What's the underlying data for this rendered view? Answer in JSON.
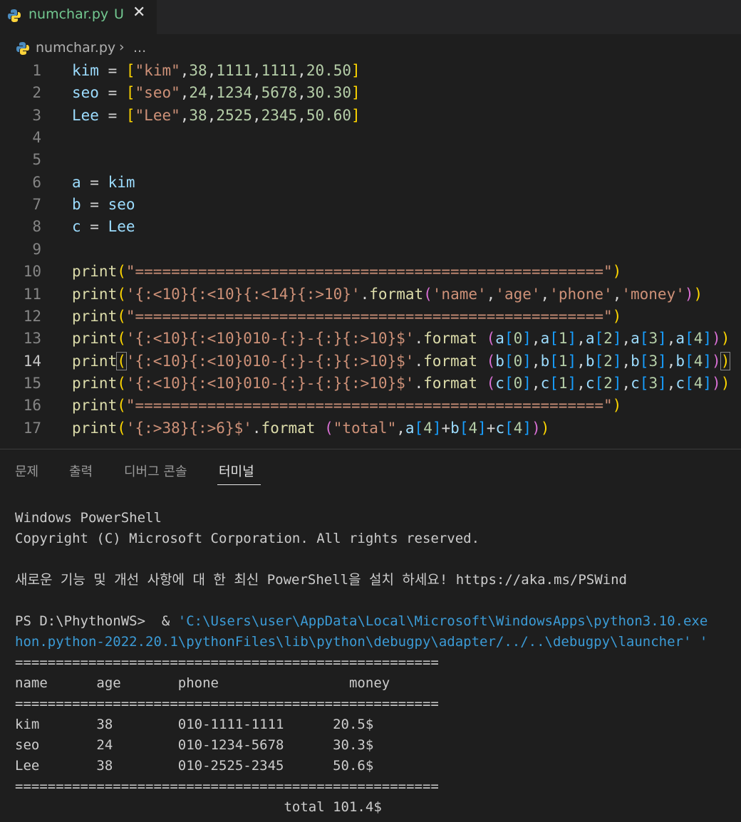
{
  "window": {
    "tab": {
      "label": "numchar.py",
      "status": "U",
      "close": "✕"
    },
    "breadcrumb": {
      "file": "numchar.py",
      "separator": "›",
      "more": "..."
    }
  },
  "editor": {
    "active_line": 14,
    "lines": [
      {
        "n": "1",
        "tokens": [
          [
            "kim",
            "kw"
          ],
          [
            " = ",
            "op"
          ],
          [
            "[",
            "b1"
          ],
          [
            "\"kim\"",
            "st"
          ],
          [
            ",",
            "op"
          ],
          [
            "38",
            "nm"
          ],
          [
            ",",
            "op"
          ],
          [
            "1111",
            "nm"
          ],
          [
            ",",
            "op"
          ],
          [
            "1111",
            "nm"
          ],
          [
            ",",
            "op"
          ],
          [
            "20.50",
            "nm"
          ],
          [
            "]",
            "b1"
          ]
        ]
      },
      {
        "n": "2",
        "tokens": [
          [
            "seo",
            "kw"
          ],
          [
            " = ",
            "op"
          ],
          [
            "[",
            "b1"
          ],
          [
            "\"seo\"",
            "st"
          ],
          [
            ",",
            "op"
          ],
          [
            "24",
            "nm"
          ],
          [
            ",",
            "op"
          ],
          [
            "1234",
            "nm"
          ],
          [
            ",",
            "op"
          ],
          [
            "5678",
            "nm"
          ],
          [
            ",",
            "op"
          ],
          [
            "30.30",
            "nm"
          ],
          [
            "]",
            "b1"
          ]
        ]
      },
      {
        "n": "3",
        "tokens": [
          [
            "Lee",
            "kw"
          ],
          [
            " = ",
            "op"
          ],
          [
            "[",
            "b1"
          ],
          [
            "\"Lee\"",
            "st"
          ],
          [
            ",",
            "op"
          ],
          [
            "38",
            "nm"
          ],
          [
            ",",
            "op"
          ],
          [
            "2525",
            "nm"
          ],
          [
            ",",
            "op"
          ],
          [
            "2345",
            "nm"
          ],
          [
            ",",
            "op"
          ],
          [
            "50.60",
            "nm"
          ],
          [
            "]",
            "b1"
          ]
        ]
      },
      {
        "n": "4",
        "tokens": []
      },
      {
        "n": "5",
        "tokens": []
      },
      {
        "n": "6",
        "tokens": [
          [
            "a",
            "kw"
          ],
          [
            " = ",
            "op"
          ],
          [
            "kim",
            "kw"
          ]
        ]
      },
      {
        "n": "7",
        "tokens": [
          [
            "b",
            "kw"
          ],
          [
            " = ",
            "op"
          ],
          [
            "seo",
            "kw"
          ]
        ]
      },
      {
        "n": "8",
        "tokens": [
          [
            "c",
            "kw"
          ],
          [
            " = ",
            "op"
          ],
          [
            "Lee",
            "kw"
          ]
        ]
      },
      {
        "n": "9",
        "tokens": []
      },
      {
        "n": "10",
        "tokens": [
          [
            "print",
            "fn"
          ],
          [
            "(",
            "b1"
          ],
          [
            "\"====================================================\"",
            "st"
          ],
          [
            ")",
            "b1"
          ]
        ]
      },
      {
        "n": "11",
        "tokens": [
          [
            "print",
            "fn"
          ],
          [
            "(",
            "b1"
          ],
          [
            "'{:<10}{:<10}{:<14}{:>10}'",
            "st"
          ],
          [
            ".",
            "op"
          ],
          [
            "format",
            "fn"
          ],
          [
            "(",
            "b2"
          ],
          [
            "'name'",
            "st"
          ],
          [
            ",",
            "op"
          ],
          [
            "'age'",
            "st"
          ],
          [
            ",",
            "op"
          ],
          [
            "'phone'",
            "st"
          ],
          [
            ",",
            "op"
          ],
          [
            "'money'",
            "st"
          ],
          [
            ")",
            "b2"
          ],
          [
            ")",
            "b1"
          ]
        ]
      },
      {
        "n": "12",
        "tokens": [
          [
            "print",
            "fn"
          ],
          [
            "(",
            "b1"
          ],
          [
            "\"====================================================\"",
            "st"
          ],
          [
            ")",
            "b1"
          ]
        ]
      },
      {
        "n": "13",
        "tokens": [
          [
            "print",
            "fn"
          ],
          [
            "(",
            "b1"
          ],
          [
            "'{:<10}{:<10}010-{:}-{:}{:>10}$'",
            "st"
          ],
          [
            ".",
            "op"
          ],
          [
            "format",
            "fn"
          ],
          [
            " ",
            "op"
          ],
          [
            "(",
            "b2"
          ],
          [
            "a",
            "kw"
          ],
          [
            "[",
            "b3"
          ],
          [
            "0",
            "nm"
          ],
          [
            "]",
            "b3"
          ],
          [
            ",",
            "op"
          ],
          [
            "a",
            "kw"
          ],
          [
            "[",
            "b3"
          ],
          [
            "1",
            "nm"
          ],
          [
            "]",
            "b3"
          ],
          [
            ",",
            "op"
          ],
          [
            "a",
            "kw"
          ],
          [
            "[",
            "b3"
          ],
          [
            "2",
            "nm"
          ],
          [
            "]",
            "b3"
          ],
          [
            ",",
            "op"
          ],
          [
            "a",
            "kw"
          ],
          [
            "[",
            "b3"
          ],
          [
            "3",
            "nm"
          ],
          [
            "]",
            "b3"
          ],
          [
            ",",
            "op"
          ],
          [
            "a",
            "kw"
          ],
          [
            "[",
            "b3"
          ],
          [
            "4",
            "nm"
          ],
          [
            "]",
            "b3"
          ],
          [
            ")",
            "b2"
          ],
          [
            ")",
            "b1"
          ]
        ]
      },
      {
        "n": "14",
        "tokens": [
          [
            "print",
            "fn"
          ],
          [
            "(",
            "b1 br-match"
          ],
          [
            "'{:<10}{:<10}010-{:}-{:}{:>10}$'",
            "st"
          ],
          [
            ".",
            "op"
          ],
          [
            "format",
            "fn"
          ],
          [
            " ",
            "op"
          ],
          [
            "(",
            "b2"
          ],
          [
            "b",
            "kw"
          ],
          [
            "[",
            "b3"
          ],
          [
            "0",
            "nm"
          ],
          [
            "]",
            "b3"
          ],
          [
            ",",
            "op"
          ],
          [
            "b",
            "kw"
          ],
          [
            "[",
            "b3"
          ],
          [
            "1",
            "nm"
          ],
          [
            "]",
            "b3"
          ],
          [
            ",",
            "op"
          ],
          [
            "b",
            "kw"
          ],
          [
            "[",
            "b3"
          ],
          [
            "2",
            "nm"
          ],
          [
            "]",
            "b3"
          ],
          [
            ",",
            "op"
          ],
          [
            "b",
            "kw"
          ],
          [
            "[",
            "b3"
          ],
          [
            "3",
            "nm"
          ],
          [
            "]",
            "b3"
          ],
          [
            ",",
            "op"
          ],
          [
            "b",
            "kw"
          ],
          [
            "[",
            "b3"
          ],
          [
            "4",
            "nm"
          ],
          [
            "]",
            "b3"
          ],
          [
            ")",
            "b2"
          ],
          [
            ")",
            "b1 br-match"
          ]
        ]
      },
      {
        "n": "15",
        "tokens": [
          [
            "print",
            "fn"
          ],
          [
            "(",
            "b1"
          ],
          [
            "'{:<10}{:<10}010-{:}-{:}{:>10}$'",
            "st"
          ],
          [
            ".",
            "op"
          ],
          [
            "format",
            "fn"
          ],
          [
            " ",
            "op"
          ],
          [
            "(",
            "b2"
          ],
          [
            "c",
            "kw"
          ],
          [
            "[",
            "b3"
          ],
          [
            "0",
            "nm"
          ],
          [
            "]",
            "b3"
          ],
          [
            ",",
            "op"
          ],
          [
            "c",
            "kw"
          ],
          [
            "[",
            "b3"
          ],
          [
            "1",
            "nm"
          ],
          [
            "]",
            "b3"
          ],
          [
            ",",
            "op"
          ],
          [
            "c",
            "kw"
          ],
          [
            "[",
            "b3"
          ],
          [
            "2",
            "nm"
          ],
          [
            "]",
            "b3"
          ],
          [
            ",",
            "op"
          ],
          [
            "c",
            "kw"
          ],
          [
            "[",
            "b3"
          ],
          [
            "3",
            "nm"
          ],
          [
            "]",
            "b3"
          ],
          [
            ",",
            "op"
          ],
          [
            "c",
            "kw"
          ],
          [
            "[",
            "b3"
          ],
          [
            "4",
            "nm"
          ],
          [
            "]",
            "b3"
          ],
          [
            ")",
            "b2"
          ],
          [
            ")",
            "b1"
          ]
        ]
      },
      {
        "n": "16",
        "tokens": [
          [
            "print",
            "fn"
          ],
          [
            "(",
            "b1"
          ],
          [
            "\"====================================================\"",
            "st"
          ],
          [
            ")",
            "b1"
          ]
        ]
      },
      {
        "n": "17",
        "tokens": [
          [
            "print",
            "fn"
          ],
          [
            "(",
            "b1"
          ],
          [
            "'{:>38}{:>6}$'",
            "st"
          ],
          [
            ".",
            "op"
          ],
          [
            "format",
            "fn"
          ],
          [
            " ",
            "op"
          ],
          [
            "(",
            "b2"
          ],
          [
            "\"total\"",
            "st"
          ],
          [
            ",",
            "op"
          ],
          [
            "a",
            "kw"
          ],
          [
            "[",
            "b3"
          ],
          [
            "4",
            "nm"
          ],
          [
            "]",
            "b3"
          ],
          [
            "+",
            "op"
          ],
          [
            "b",
            "kw"
          ],
          [
            "[",
            "b3"
          ],
          [
            "4",
            "nm"
          ],
          [
            "]",
            "b3"
          ],
          [
            "+",
            "op"
          ],
          [
            "c",
            "kw"
          ],
          [
            "[",
            "b3"
          ],
          [
            "4",
            "nm"
          ],
          [
            "]",
            "b3"
          ],
          [
            ")",
            "b2"
          ],
          [
            ")",
            "b1"
          ]
        ]
      }
    ]
  },
  "panel": {
    "tabs": [
      "문제",
      "출력",
      "디버그 콘솔",
      "터미널"
    ],
    "active_tab": "터미널"
  },
  "terminal": {
    "lines": [
      {
        "text": "Windows PowerShell",
        "style": ""
      },
      {
        "text": "Copyright (C) Microsoft Corporation. All rights reserved.",
        "style": ""
      },
      {
        "text": "",
        "style": ""
      },
      {
        "text": "새로운 기능 및 개선 사항에 대 한 최신 PowerShell을 설치 하세요! https://aka.ms/PSWind",
        "style": ""
      },
      {
        "text": "",
        "style": ""
      },
      {
        "text": "PS D:\\PhythonWS>  & 'C:\\Users\\user\\AppData\\Local\\Microsoft\\WindowsApps\\python3.10.exe",
        "style": "mixed"
      },
      {
        "text": "hon.python-2022.20.1\\pythonFiles\\lib\\python\\debugpy\\adapter/../..\\debugpy\\launcher' '",
        "style": "link"
      },
      {
        "text": "====================================================",
        "style": ""
      },
      {
        "text": "name      age       phone                money",
        "style": ""
      },
      {
        "text": "====================================================",
        "style": ""
      },
      {
        "text": "kim       38        010-1111-1111      20.5$",
        "style": ""
      },
      {
        "text": "seo       24        010-1234-5678      30.3$",
        "style": ""
      },
      {
        "text": "Lee       38        010-2525-2345      50.6$",
        "style": ""
      },
      {
        "text": "====================================================",
        "style": ""
      },
      {
        "text": "                                 total 101.4$",
        "style": ""
      }
    ]
  },
  "colors": {
    "editor_bg": "#1e1e1e",
    "tab_bar_bg": "#252526",
    "untracked_green": "#73c991",
    "python_icon_blue": "#4b8bbe",
    "python_icon_yellow": "#ffd43b"
  },
  "icons": [
    "python-file-icon",
    "close-icon",
    "chevron-right-icon"
  ]
}
